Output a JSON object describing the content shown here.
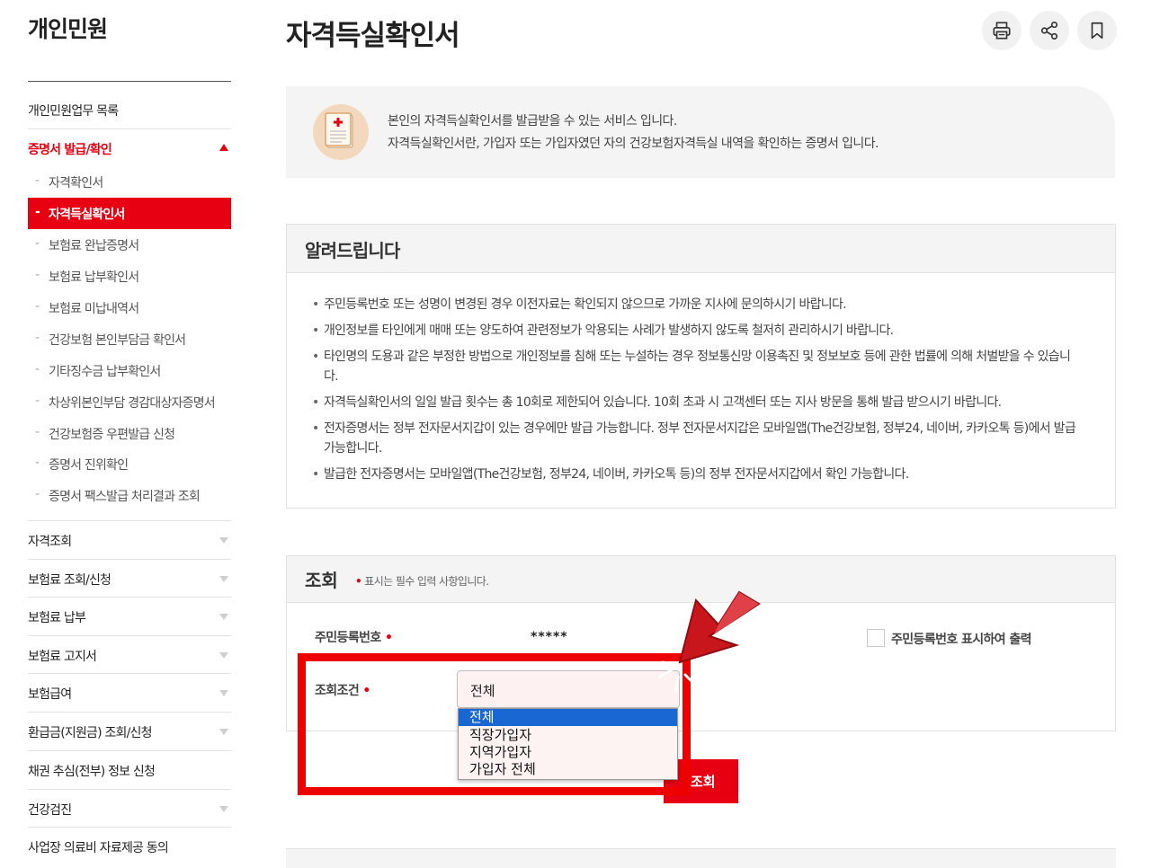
{
  "sidebar": {
    "title": "개인민원",
    "items": [
      {
        "label": "개인민원업무 목록"
      },
      {
        "label": "증명서 발급/확인"
      },
      {
        "label": "자격조회"
      },
      {
        "label": "보험료 조회/신청"
      },
      {
        "label": "보험료 납부"
      },
      {
        "label": "보험료 고지서"
      },
      {
        "label": "보험급여"
      },
      {
        "label": "환급금(지원금) 조회/신청"
      },
      {
        "label": "채권 추심(전부) 정보 신청"
      },
      {
        "label": "건강검진"
      },
      {
        "label": "사업장 의료비 자료제공 동의"
      }
    ],
    "subitems": [
      {
        "label": "자격확인서"
      },
      {
        "label": "자격득실확인서"
      },
      {
        "label": "보험료 완납증명서"
      },
      {
        "label": "보험료 납부확인서"
      },
      {
        "label": "보험료 미납내역서"
      },
      {
        "label": "건강보험 본인부담금 확인서"
      },
      {
        "label": "기타징수금 납부확인서"
      },
      {
        "label": "차상위본인부담 경감대상자증명서"
      },
      {
        "label": "건강보험증 우편발급 신청"
      },
      {
        "label": "증명서 진위확인"
      },
      {
        "label": "증명서 팩스발급 처리결과 조회"
      }
    ]
  },
  "header": {
    "title": "자격득실확인서",
    "tools": [
      "printer-icon",
      "share-icon",
      "bookmark-icon"
    ]
  },
  "intro": {
    "line1": "본인의 자격득실확인서를 발급받을 수 있는 서비스 입니다.",
    "line2": "자격득실확인서란, 가입자 또는 가입자였던 자의 건강보험자격득실 내역을 확인하는 증명서 입니다."
  },
  "notice": {
    "title": "알려드립니다",
    "items": [
      "주민등록번호 또는 성명이 변경된 경우 이전자료는 확인되지 않으므로 가까운 지사에 문의하시기 바랍니다.",
      "개인정보를 타인에게 매매 또는 양도하여 관련정보가 악용되는 사례가 발생하지 않도록 철저히 관리하시기 바랍니다.",
      "타인명의 도용과 같은 부정한 방법으로 개인정보를 침해 또는 누설하는 경우 정보통신망 이용촉진 및 정보보호 등에 관한 법률에 의해 처벌받을 수 있습니다.",
      "자격득실확인서의 일일 발급 횟수는 총 10회로 제한되어 있습니다. 10회 초과 시 고객센터 또는 지사 방문을 통해 발급 받으시기 바랍니다.",
      "전자증명서는 정부 전자문서지갑이 있는 경우에만 발급 가능합니다. 정부 전자문서지갑은 모바일앱(The건강보험, 정부24, 네이버, 카카오톡 등)에서 발급 가능합니다.",
      "발급한 전자증명서는 모바일앱(The건강보험, 정부24, 네이버, 카카오톡 등)의 정부 전자문서지갑에서 확인 가능합니다."
    ]
  },
  "search": {
    "title": "조회",
    "required_mark": "•",
    "note": "표시는 필수 입력 사항입니다.",
    "rrn_label": "주민등록번호",
    "rrn_value": "*****",
    "checkbox_label": "주민등록번호 표시하여 출력",
    "condition_label": "조회조건",
    "select_value": "전체",
    "options": [
      "전체",
      "직장가입자",
      "지역가입자",
      "가입자 전체"
    ],
    "button_label": "조회"
  },
  "colors": {
    "accent": "#e60012",
    "highlight": "#ee0000",
    "option_selected": "#1967d2"
  }
}
